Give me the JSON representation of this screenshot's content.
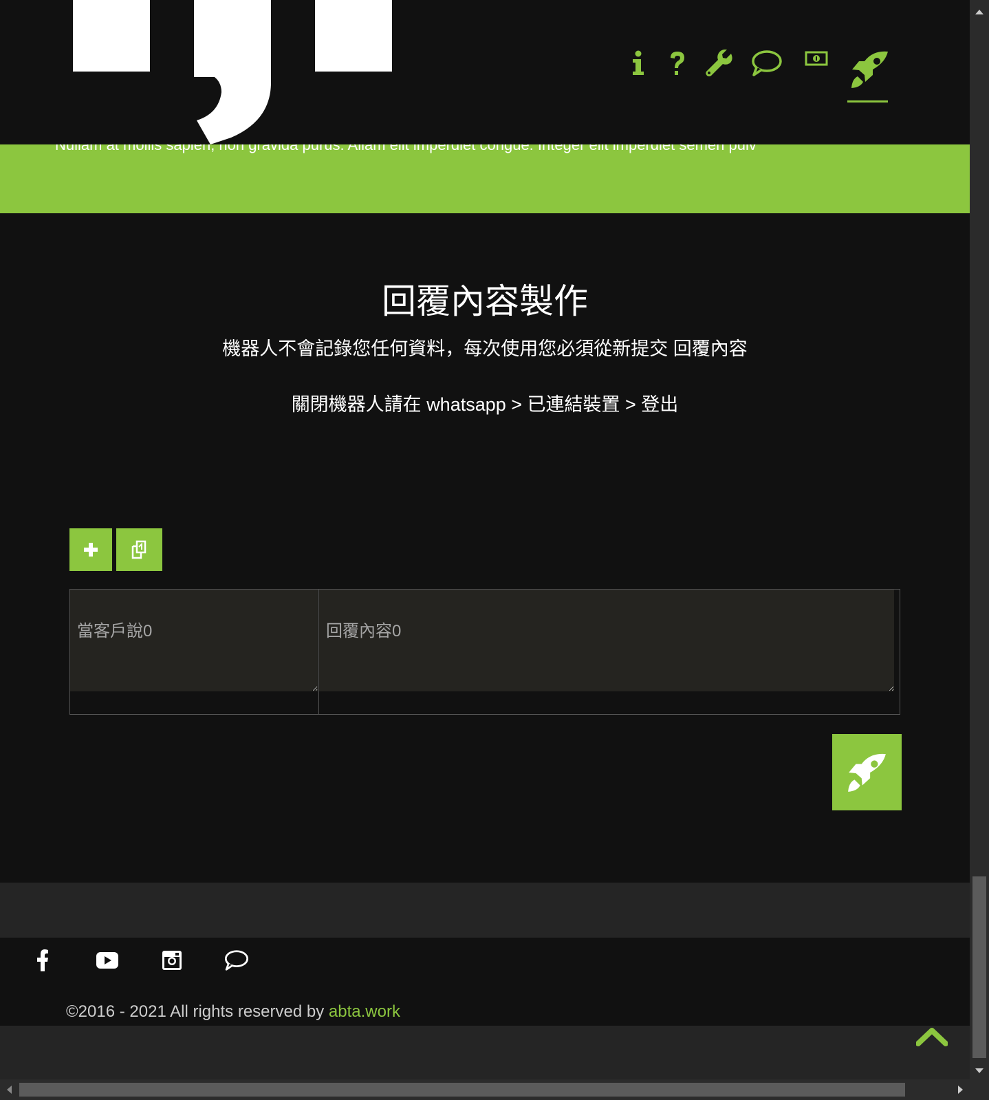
{
  "header": {
    "nav": [
      {
        "name": "info-icon"
      },
      {
        "name": "help-icon"
      },
      {
        "name": "wrench-icon"
      },
      {
        "name": "chat-bubble-icon"
      },
      {
        "name": "money-icon"
      },
      {
        "name": "rocket-icon",
        "active": true
      }
    ]
  },
  "band": {
    "text": "Nullam at mollis sapien, non gravida purus. Aliam elit imperdiet congue. Integer elit imperdiet semen pulv"
  },
  "main": {
    "title": "回覆內容製作",
    "subtitle": "機器人不會記錄您任何資料，每次使用您必須從新提交 回覆內容",
    "instruction": "關閉機器人請在 whatsapp > 已連結裝置 > 登出",
    "add_button_icon": "plus-icon",
    "copy_button_icon": "copy-icon",
    "rows": [
      {
        "customer_says_placeholder": "當客戶說0",
        "reply_placeholder": "回覆內容0",
        "customer_says_value": "",
        "reply_value": ""
      }
    ],
    "send_button_icon": "rocket-icon"
  },
  "footer": {
    "social": [
      "facebook-icon",
      "youtube-icon",
      "instagram-icon",
      "chat-bubble-icon"
    ],
    "copyright_prefix": "©2016 - 2021 All rights reserved by ",
    "copyright_link": "abta.work",
    "back_to_top_icon": "chevron-up-icon"
  },
  "colors": {
    "accent": "#8cc63f",
    "background": "#111111",
    "footer_band": "#252525",
    "textarea_bg": "#252420"
  }
}
